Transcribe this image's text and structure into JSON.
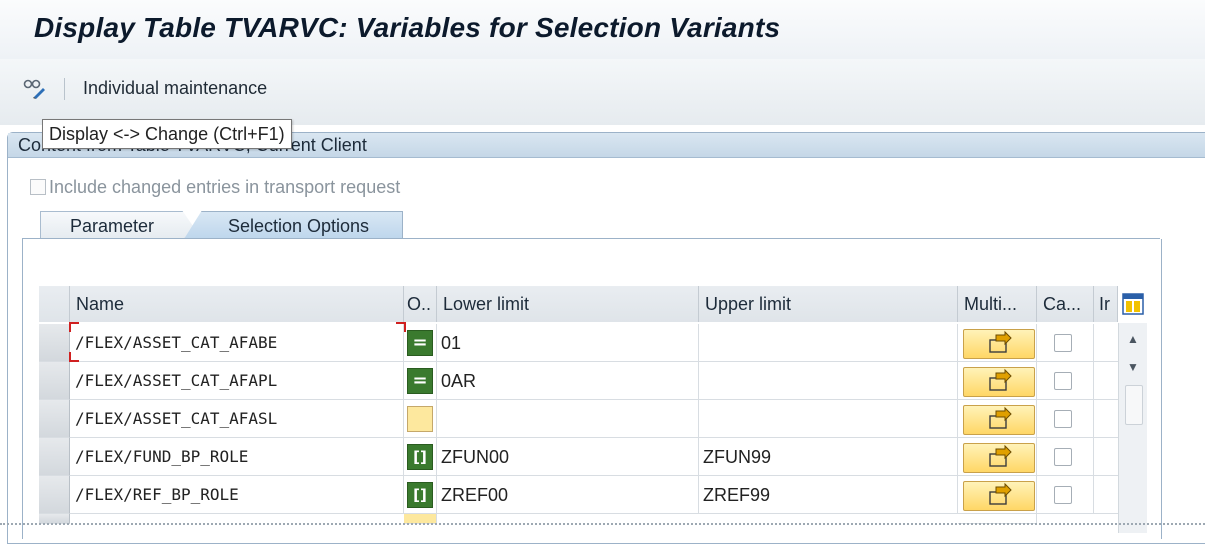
{
  "window": {
    "title": "Display Table TVARVC: Variables for Selection Variants"
  },
  "toolbar": {
    "toggle_icon": "display-change-glasses-pencil-icon",
    "individual_maintenance": "Individual maintenance"
  },
  "tooltip": {
    "text": "Display <-> Change   (Ctrl+F1)"
  },
  "panel": {
    "title": "Content from Table TVARVC, Current Client",
    "include_transport": {
      "label": "Include changed entries in transport request",
      "checked": false,
      "enabled": false
    }
  },
  "tabs": [
    {
      "label": "Parameter",
      "active": false
    },
    {
      "label": "Selection Options",
      "active": true
    }
  ],
  "table": {
    "columns": [
      "Name",
      "O..",
      "Lower limit",
      "Upper limit",
      "Multi...",
      "Ca...",
      "Ir"
    ],
    "rows": [
      {
        "name": "/FLEX/ASSET_CAT_AFABE",
        "option": "=",
        "option_icon": "equals-option-icon",
        "lower": "01",
        "upper": ""
      },
      {
        "name": "/FLEX/ASSET_CAT_AFAPL",
        "option": "=",
        "option_icon": "equals-option-icon",
        "lower": "0AR",
        "upper": ""
      },
      {
        "name": "/FLEX/ASSET_CAT_AFASL",
        "option": "",
        "option_icon": "",
        "lower": "",
        "upper": ""
      },
      {
        "name": "/FLEX/FUND_BP_ROLE",
        "option": "[]",
        "option_icon": "between-option-icon",
        "lower": "ZFUN00",
        "upper": "ZFUN99"
      },
      {
        "name": "/FLEX/REF_BP_ROLE",
        "option": "[]",
        "option_icon": "between-option-icon",
        "lower": "ZREF00",
        "upper": "ZREF99"
      }
    ]
  },
  "colors": {
    "option_green": "#3a7a2e",
    "multi_button_yellow": "#ffd766",
    "panel_blue": "#c5d7e7"
  }
}
